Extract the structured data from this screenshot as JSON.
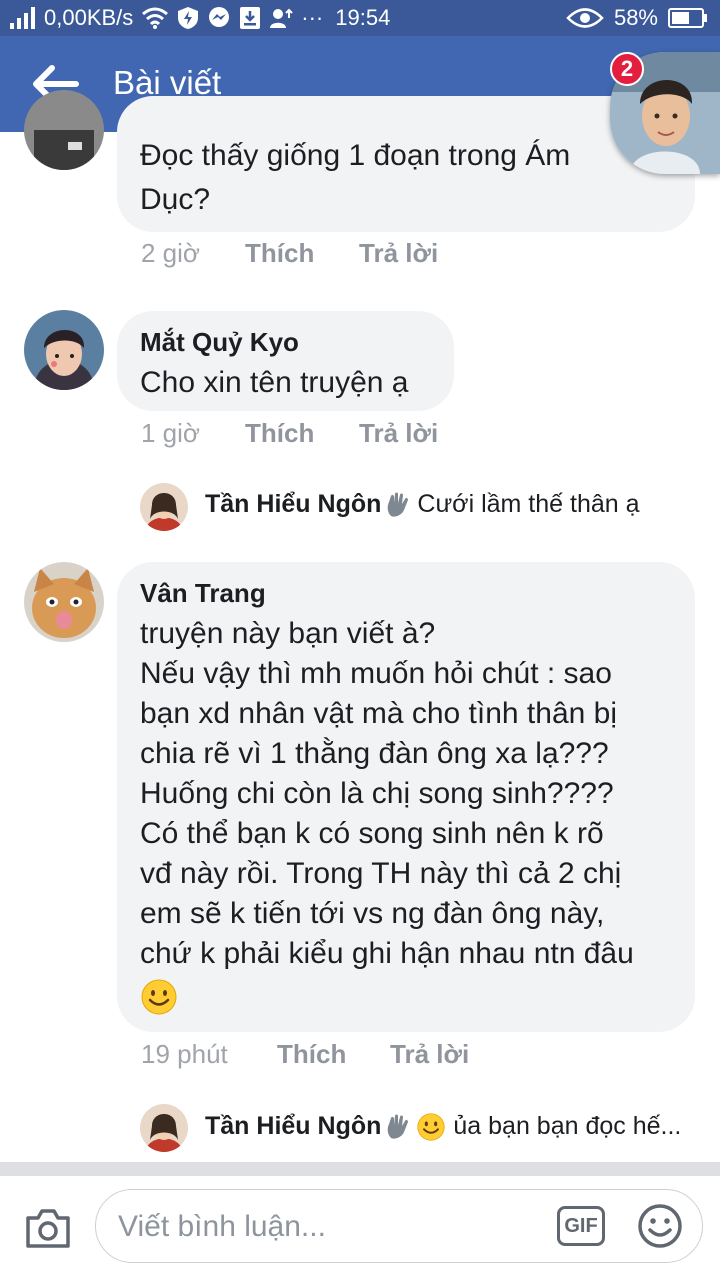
{
  "status_bar": {
    "net_speed": "0,00KB/s",
    "time": "19:54",
    "battery": "58%",
    "dots": "···"
  },
  "header": {
    "title": "Bài viết",
    "chat_badge": "2"
  },
  "comments": [
    {
      "text_lines": [
        "Đọc thấy giống 1 đoạn trong Ám",
        "Dục?"
      ],
      "time": "2 giờ",
      "like": "Thích",
      "reply": "Trả lời"
    },
    {
      "name": "Mắt Quỷ Kyo",
      "text_lines": [
        "Cho xin tên truyện ạ"
      ],
      "time": "1 giờ",
      "like": "Thích",
      "reply": "Trả lời",
      "reply_preview": {
        "name": "Tần Hiểu Ngôn",
        "text": "Cưới lầm thế thân ạ"
      }
    },
    {
      "name": "Vân Trang",
      "text_lines": [
        "truyện này bạn viết à?",
        "Nếu vậy thì mh muốn hỏi chút : sao",
        "bạn xd nhân vật mà cho tình thân bị",
        "chia rẽ vì 1 thằng đàn ông xa lạ???",
        "Huống chi còn là chị song sinh????",
        "Có thể bạn k có song sinh nên k rõ",
        "vđ này rồi. Trong TH  này thì cả 2 chị",
        "em sẽ k tiến tới vs ng đàn ông này,",
        "chứ k phải kiểu ghi hận nhau ntn đâu"
      ],
      "time": "19 phút",
      "like": "Thích",
      "reply": "Trả lời",
      "reply_preview": {
        "name": "Tần Hiểu Ngôn",
        "text": "ủa bạn bạn đọc hế..."
      }
    }
  ],
  "composer": {
    "placeholder": "Viết bình luận...",
    "gif_label": "GIF"
  },
  "colors": {
    "status_bar": "#3b5998",
    "header": "#4267b2",
    "bubble": "#f2f3f5",
    "meta_text": "#90949c",
    "badge": "#e41e3f"
  }
}
